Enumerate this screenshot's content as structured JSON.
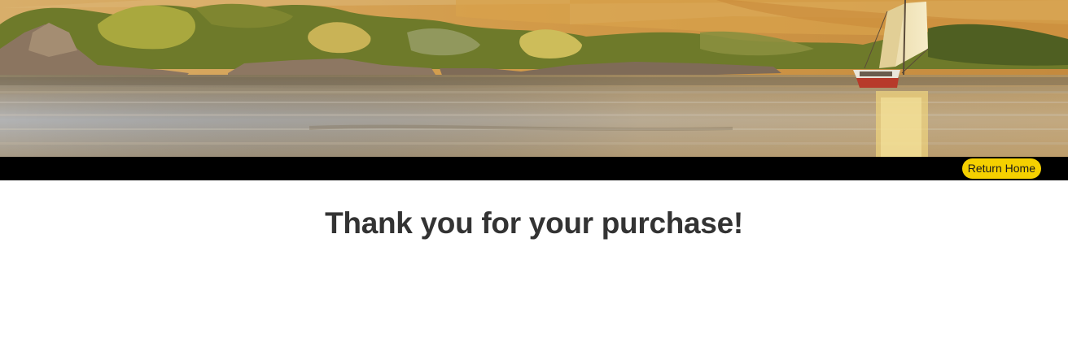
{
  "hero": {
    "image_description_icon": "nile-river-felucca-landscape"
  },
  "navbar": {
    "return_home_label": "Return Home",
    "accent_color": "#f5d000",
    "bar_color": "#000000"
  },
  "main": {
    "title": "Thank you for your purchase!"
  }
}
